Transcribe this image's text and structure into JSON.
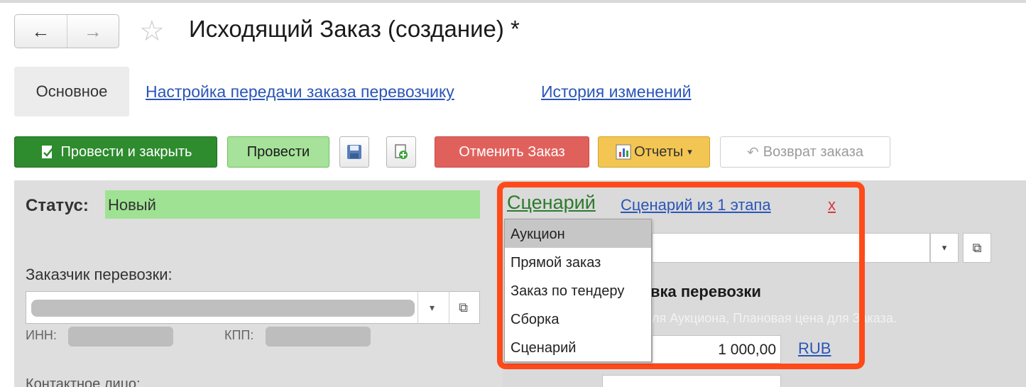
{
  "window": {
    "title": "Исходящий Заказ (создание) *",
    "back_icon": "←",
    "forward_icon": "→",
    "favorite_icon": "☆"
  },
  "tabs": [
    {
      "label": "Основное",
      "active": true
    },
    {
      "label": "Настройка передачи заказа перевозчику"
    },
    {
      "label": "История изменений"
    }
  ],
  "toolbar": {
    "post_close_label": "Провести и закрыть",
    "post_label": "Провести",
    "cancel_order_label": "Отменить Заказ",
    "reports_label": "Отчеты",
    "return_label": "Возврат заказа"
  },
  "form": {
    "status_label": "Статус:",
    "status_value": "Новый",
    "customer_label": "Заказчик перевозки:",
    "inn_label": "ИНН:",
    "kpp_label": "КПП:",
    "contact_label_cut": "Контактное лицо:",
    "dropdown_arrow": "▾",
    "open_icon": "⧉"
  },
  "scenario": {
    "label": "Сценарий",
    "link": "Сценарий из 1 этапа",
    "clear": "x",
    "options": [
      "Аукцион",
      "Прямой заказ",
      "Заказ по тендеру",
      "Сборка",
      "Сценарий"
    ],
    "selected_index": 0
  },
  "pricing": {
    "section_title_partial": "вка перевозки",
    "hint_partial": "ля Аукциона, Плановая цена для Заказа.",
    "price_value": "1 000,00",
    "currency": "RUB"
  },
  "colors": {
    "accent_green": "#2e8b2e",
    "status_green": "#9fe293",
    "cancel_red": "#e0615c",
    "reports_yellow": "#f3c653",
    "highlight": "#ff4a1a",
    "link_blue": "#2a55b8"
  }
}
